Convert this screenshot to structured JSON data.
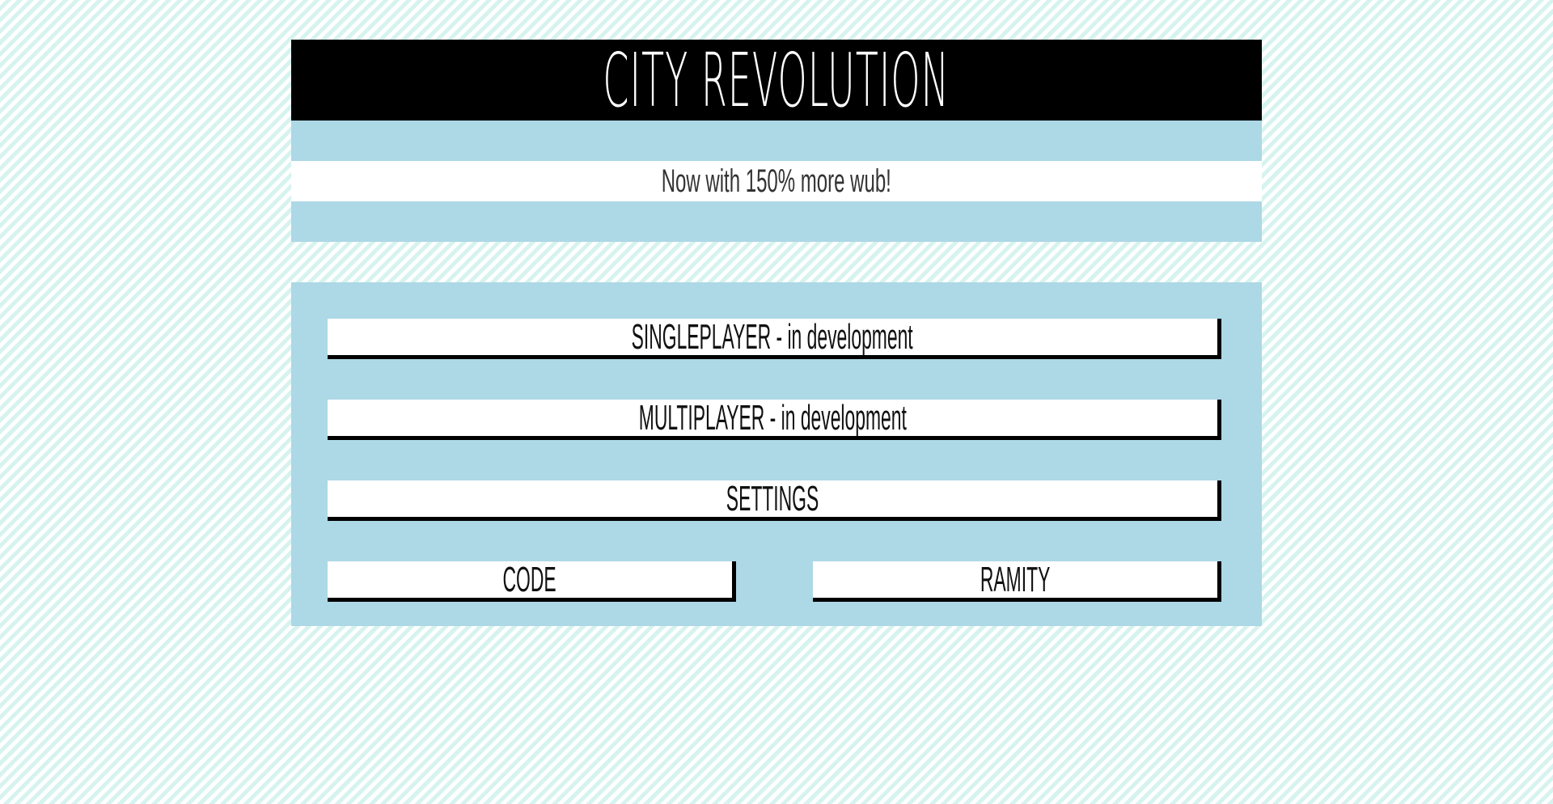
{
  "header": {
    "title": "CITY REVOLUTION",
    "tagline": "Now with 150% more wub!"
  },
  "menu": {
    "singleplayer": "SINGLEPLAYER - in development",
    "multiplayer": "MULTIPLAYER - in development",
    "settings": "SETTINGS",
    "code": "CODE",
    "ramity": "RAMITY"
  },
  "colors": {
    "panel": "#add8e6",
    "title_bar": "#000000",
    "stripe": "#d6f3ef"
  }
}
